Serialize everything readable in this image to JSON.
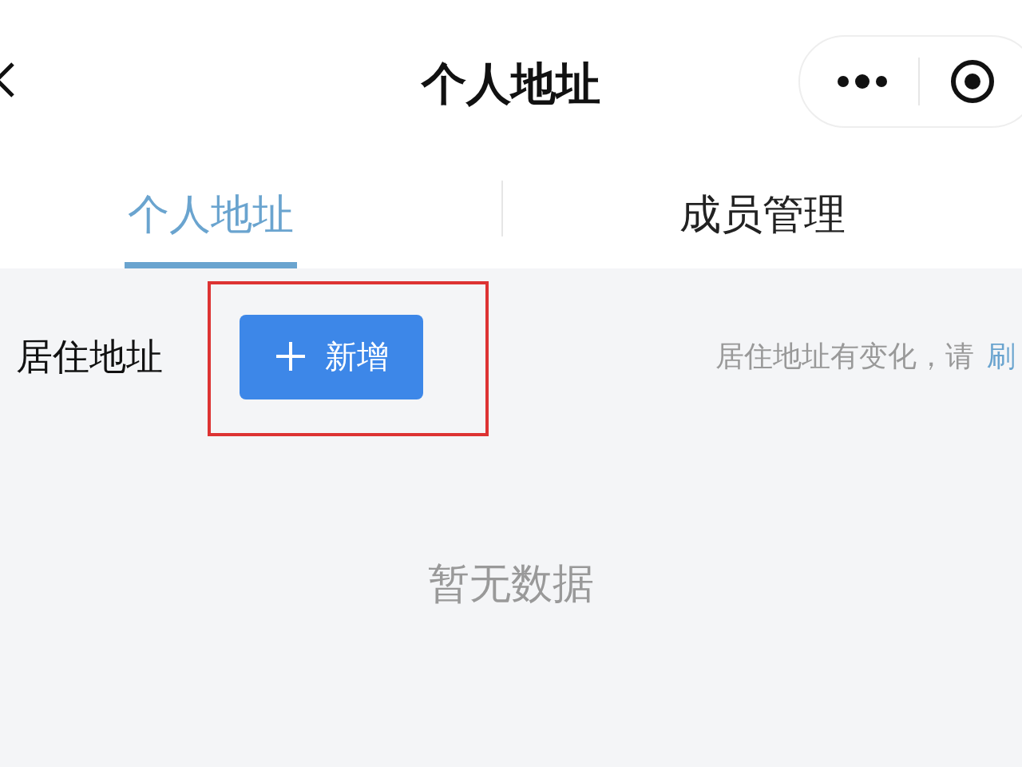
{
  "header": {
    "title": "个人地址"
  },
  "tabs": [
    {
      "label": "个人地址",
      "selected": true
    },
    {
      "label": "成员管理",
      "selected": false
    }
  ],
  "address_row": {
    "label": "居住地址",
    "button": "新增",
    "hint": "居住地址有变化，请",
    "link": "刷"
  },
  "empty_text": "暂无数据"
}
